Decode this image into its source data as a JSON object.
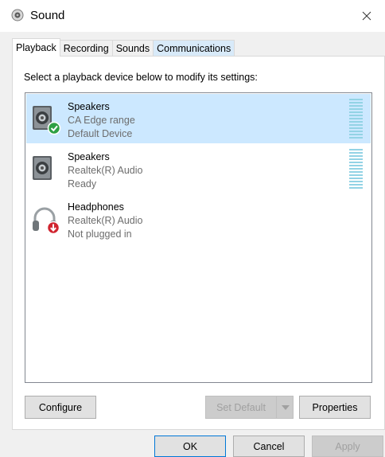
{
  "window": {
    "title": "Sound",
    "icon": "speaker-icon",
    "close_glyph": "✕"
  },
  "tabs": [
    {
      "label": "Playback",
      "active": true
    },
    {
      "label": "Recording",
      "active": false
    },
    {
      "label": "Sounds",
      "active": false
    },
    {
      "label": "Communications",
      "active": false
    }
  ],
  "playback": {
    "instruction": "Select a playback device below to modify its settings:",
    "devices": [
      {
        "name": "Speakers",
        "description": "CA Edge range",
        "status": "Default Device",
        "icon": "speaker-icon",
        "badge": "default-check-icon",
        "selected": true,
        "level": 0
      },
      {
        "name": "Speakers",
        "description": "Realtek(R) Audio",
        "status": "Ready",
        "icon": "speaker-icon",
        "badge": "",
        "selected": false,
        "level": 0
      },
      {
        "name": "Headphones",
        "description": "Realtek(R) Audio",
        "status": "Not plugged in",
        "icon": "headphones-icon",
        "badge": "unplugged-arrow-icon",
        "selected": false,
        "level": null
      }
    ],
    "buttons": {
      "configure": "Configure",
      "set_default": "Set Default",
      "properties": "Properties"
    }
  },
  "footer": {
    "ok": "OK",
    "cancel": "Cancel",
    "apply": "Apply"
  },
  "colors": {
    "selection": "#cce8ff",
    "meter": "#93d3e5",
    "check_badge": "#2ea043",
    "unplugged_badge": "#d0242f",
    "default_button_border": "#0078d7"
  }
}
